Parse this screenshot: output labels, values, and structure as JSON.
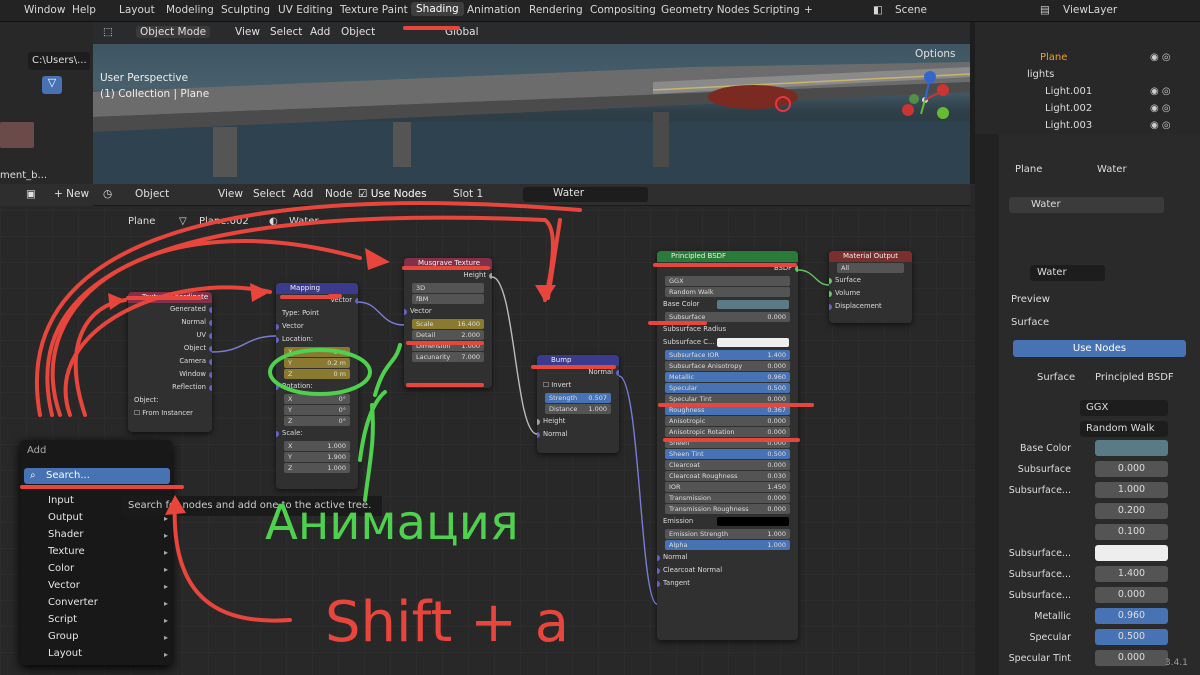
{
  "topbar": {
    "menu": [
      "Window",
      "Help"
    ],
    "tabs": [
      "Layout",
      "Modeling",
      "Sculpting",
      "UV Editing",
      "Texture Paint",
      "Shading",
      "Animation",
      "Rendering",
      "Compositing",
      "Geometry Nodes",
      "Scripting",
      "+"
    ],
    "scene": "Scene",
    "viewlayer": "ViewLayer"
  },
  "left": {
    "path": "C:\\Users\\...",
    "thumb_label": "ment_b...",
    "new_label": "New"
  },
  "viewport": {
    "mode": "Object Mode",
    "menus": [
      "View",
      "Select",
      "Add",
      "Object"
    ],
    "transform": "Global",
    "options": "Options",
    "persp": "User Perspective",
    "collection": "(1) Collection | Plane"
  },
  "node_header": {
    "object": "Object",
    "menus": [
      "View",
      "Select",
      "Add",
      "Node"
    ],
    "use_nodes": "Use Nodes",
    "slot": "Slot 1",
    "material": "Water"
  },
  "breadcrumb": [
    "Plane",
    "Plane.002",
    "Water"
  ],
  "nodes": {
    "texcoord": {
      "title": "Texture Coordinate",
      "outputs": [
        "Generated",
        "Normal",
        "UV",
        "Object",
        "Camera",
        "Window",
        "Reflection"
      ],
      "object_label": "Object:",
      "from_instancer": "From Instancer"
    },
    "mapping": {
      "title": "Mapping",
      "out": "Vector",
      "type_label": "Type:",
      "type": "Point",
      "vector": "Vector",
      "location": "Location:",
      "loc": [
        [
          "X",
          "0 m"
        ],
        [
          "Y",
          "0.2 m"
        ],
        [
          "Z",
          "0 m"
        ]
      ],
      "rotation": "Rotation:",
      "rot": [
        [
          "X",
          "0°"
        ],
        [
          "Y",
          "0°"
        ],
        [
          "Z",
          "0°"
        ]
      ],
      "scale": "Scale:",
      "scl": [
        [
          "X",
          "1.000"
        ],
        [
          "Y",
          "1.900"
        ],
        [
          "Z",
          "1.000"
        ]
      ]
    },
    "musgrave": {
      "title": "Musgrave Texture",
      "out": "Height",
      "dim": "3D",
      "type": "fBM",
      "vector": "Vector",
      "fields": [
        [
          "Scale",
          "16.400"
        ],
        [
          "Detail",
          "2.000"
        ],
        [
          "Dimension",
          "1.000"
        ],
        [
          "Lacunarity",
          "7.000"
        ]
      ]
    },
    "bump": {
      "title": "Bump",
      "out": "Normal",
      "invert": "Invert",
      "fields": [
        [
          "Strength",
          "0.507"
        ],
        [
          "Distance",
          "1.000"
        ]
      ],
      "inputs": [
        "Height",
        "Normal"
      ]
    },
    "bsdf": {
      "title": "Principled BSDF",
      "out": "BSDF",
      "dist": "GGX",
      "sss": "Random Walk",
      "rows": [
        [
          "Base Color",
          ""
        ],
        [
          "Subsurface",
          "0.000"
        ],
        [
          "Subsurface Radius",
          ""
        ],
        [
          "Subsurface C...",
          ""
        ],
        [
          "Subsurface IOR",
          "1.400"
        ],
        [
          "Subsurface Anisotropy",
          "0.000"
        ],
        [
          "Metallic",
          "0.960"
        ],
        [
          "Specular",
          "0.500"
        ],
        [
          "Specular Tint",
          "0.000"
        ],
        [
          "Roughness",
          "0.367"
        ],
        [
          "Anisotropic",
          "0.000"
        ],
        [
          "Anisotropic Rotation",
          "0.000"
        ],
        [
          "Sheen",
          "0.000"
        ],
        [
          "Sheen Tint",
          "0.500"
        ],
        [
          "Clearcoat",
          "0.000"
        ],
        [
          "Clearcoat Roughness",
          "0.030"
        ],
        [
          "IOR",
          "1.450"
        ],
        [
          "Transmission",
          "0.000"
        ],
        [
          "Transmission Roughness",
          "0.000"
        ],
        [
          "Emission",
          ""
        ],
        [
          "Emission Strength",
          "1.000"
        ],
        [
          "Alpha",
          "1.000"
        ]
      ],
      "tail": [
        "Normal",
        "Clearcoat Normal",
        "Tangent"
      ]
    },
    "output": {
      "title": "Material Output",
      "target": "All",
      "inputs": [
        "Surface",
        "Volume",
        "Displacement"
      ]
    }
  },
  "add_menu": {
    "title": "Add",
    "search": "Search...",
    "items": [
      "Input",
      "Output",
      "Shader",
      "Texture",
      "Color",
      "Vector",
      "Converter",
      "Script",
      "Group",
      "Layout"
    ],
    "tooltip": "Search for nodes and add one to the active tree."
  },
  "outliner": {
    "items": [
      "Plane",
      "lights",
      "Light.001",
      "Light.002",
      "Light.003"
    ]
  },
  "properties": {
    "breadcrumb": [
      "Plane",
      "Water"
    ],
    "slot": "Water",
    "material": "Water",
    "preview": "Preview",
    "surface": "Surface",
    "use_nodes": "Use Nodes",
    "surface_label": "Surface",
    "surface_value": "Principled BSDF",
    "dist": "GGX",
    "sss": "Random Walk",
    "rows": [
      [
        "Base Color",
        ""
      ],
      [
        "Subsurface",
        "0.000"
      ],
      [
        "Subsurface...",
        "1.000"
      ],
      [
        "",
        "0.200"
      ],
      [
        "",
        "0.100"
      ],
      [
        "Subsurface...",
        ""
      ],
      [
        "Subsurface...",
        "1.400"
      ],
      [
        "Subsurface...",
        "0.000"
      ],
      [
        "Metallic",
        "0.960"
      ],
      [
        "Specular",
        "0.500"
      ],
      [
        "Specular Tint",
        "0.000"
      ]
    ]
  },
  "version": "3.4.1",
  "annotations": {
    "green": "Анимация",
    "red": "Shift + a"
  },
  "colors": {
    "node_tex": "#83314a",
    "node_vec": "#3b3b8e",
    "node_shader": "#2a7a3a",
    "node_out": "#7a2f2f",
    "accent": "#4772b3",
    "annot_red": "#e8463c",
    "annot_green": "#4fd14f"
  }
}
